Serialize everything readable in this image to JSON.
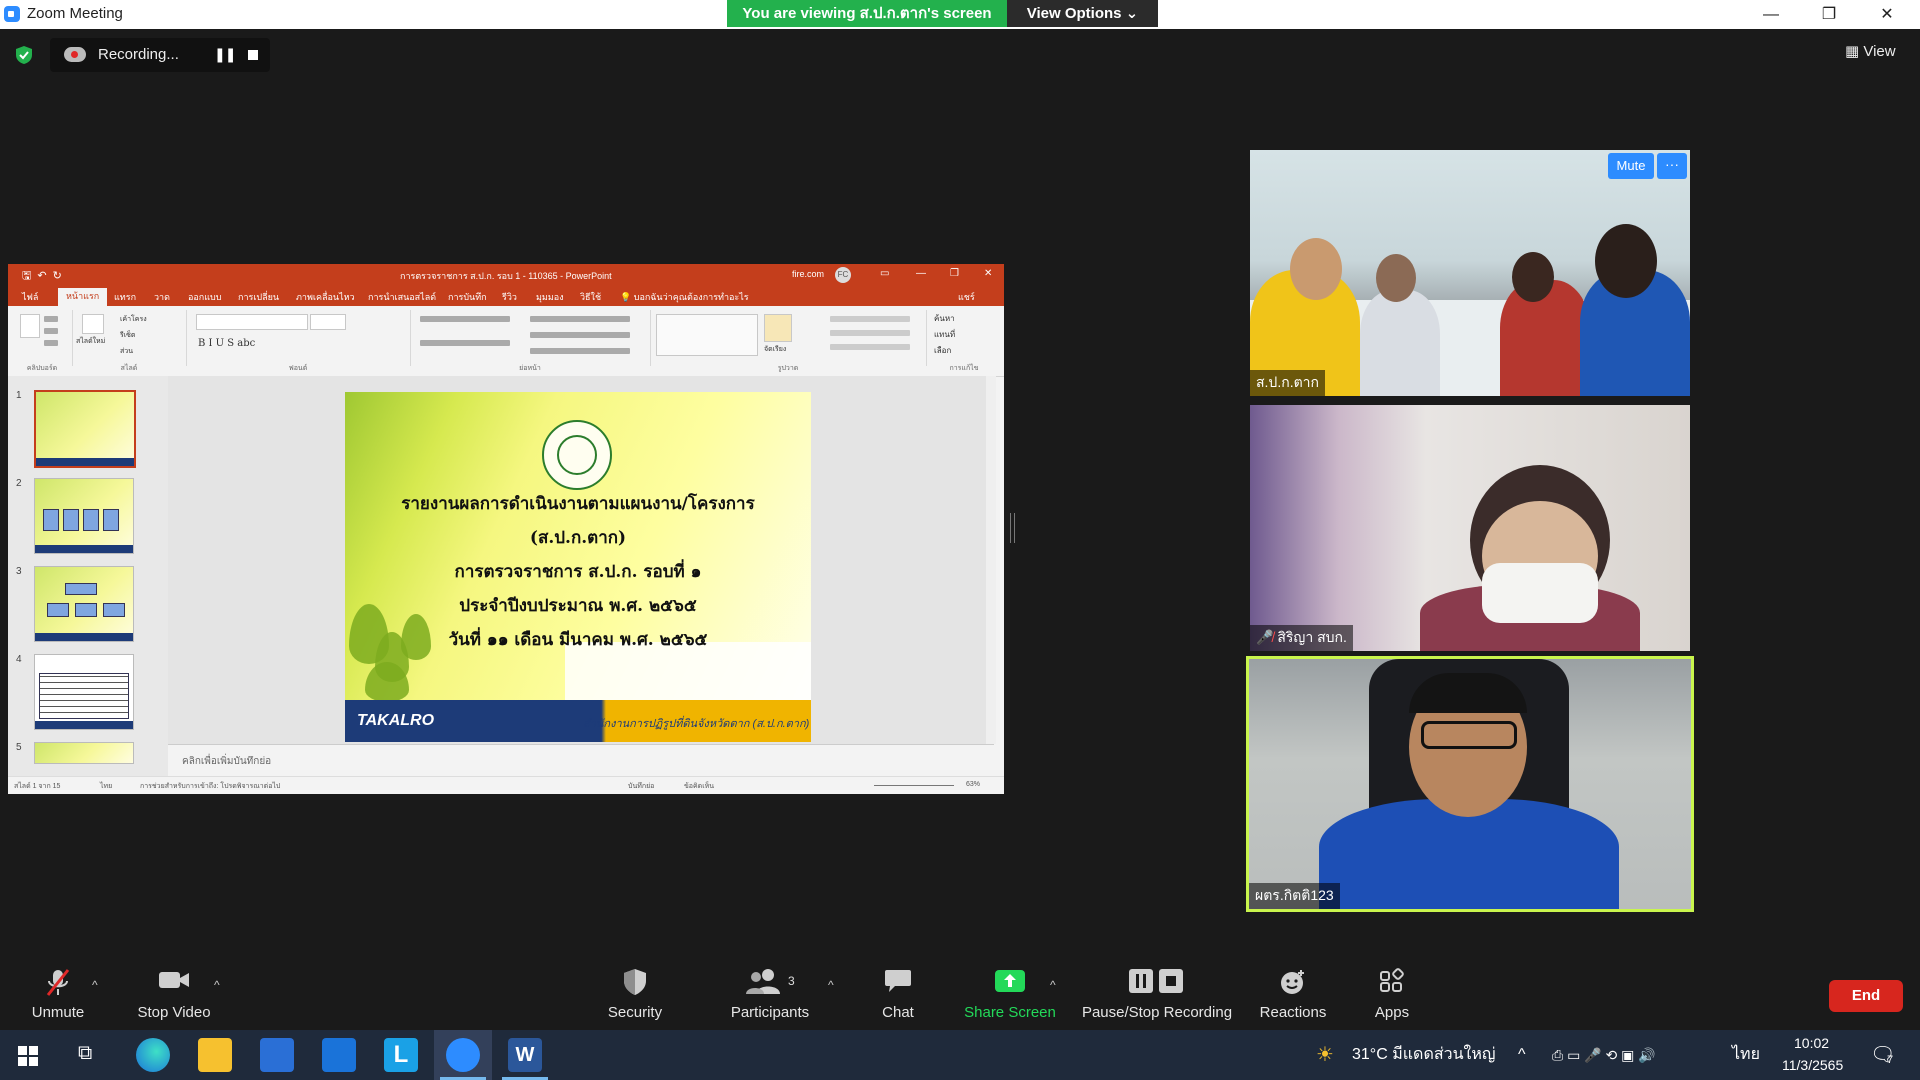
{
  "window": {
    "title": "Zoom Meeting",
    "viewing_banner": "You are viewing ส.ป.ก.ตาก's screen",
    "view_options": "View Options",
    "minimize": "—",
    "restore": "❐",
    "close": "✕"
  },
  "recording": {
    "label": "Recording...",
    "pause_glyph": "❚❚"
  },
  "view_button": "View",
  "shared_screen": {
    "doc_title": "การตรวจราชการ ส.ป.ก. รอบ 1 - 110365 - PowerPoint",
    "account": "fire.com",
    "avatar": "FC",
    "share": "แชร์",
    "tabs": [
      "ไฟล์",
      "หน้าแรก",
      "แทรก",
      "วาด",
      "ออกแบบ",
      "การเปลี่ยน",
      "ภาพเคลื่อนไหว",
      "การนำเสนอสไลด์",
      "การบันทึก",
      "รีวิว",
      "มุมมอง",
      "วิธีใช้",
      "บอกฉันว่าคุณต้องการทำอะไร"
    ],
    "ribbon_groups": [
      "คลิปบอร์ด",
      "สไลด์",
      "ฟอนต์",
      "ย่อหน้า",
      "รูปวาด",
      "การแก้ไข"
    ],
    "ribbon_items": {
      "find": "ค้นหา",
      "replace": "แทนที่",
      "select": "เลือก",
      "layout": "เค้าโครง",
      "reset": "รีเซ็ต",
      "section": "ส่วน",
      "new_slide": "สไลด์ใหม่",
      "arrange": "จัดเรียง"
    },
    "slide_numbers": [
      "1",
      "2",
      "3",
      "4",
      "5"
    ],
    "notes_placeholder": "คลิกเพื่อเพิ่มบันทึกย่อ",
    "status_left": "สไลด์ 1 จาก 15",
    "status_lang": "ไทย",
    "status_access": "การช่วยสำหรับการเข้าถึง: โปรดพิจารณาต่อไป",
    "status_notes": "บันทึกย่อ",
    "status_comments": "ข้อคิดเห็น",
    "zoom": "63%",
    "slide": {
      "line1": "รายงานผลการดำเนินงานตามแผนงาน/โครงการ",
      "line2": "(ส.ป.ก.ตาก)",
      "line3": "การตรวจราชการ ส.ป.ก. รอบที่ ๑",
      "line4": "ประจำปีงบประมาณ พ.ศ. ๒๕๖๕",
      "line5": "วันที่ ๑๑   เดือน มีนาคม  พ.ศ. ๒๕๖๕",
      "brand": "TAKALRO",
      "org": "สำนักงานการปฏิรูปที่ดินจังหวัดตาก (ส.ป.ก.ตาก)"
    }
  },
  "participants": [
    {
      "name": "ส.ป.ก.ตาก",
      "muted": false
    },
    {
      "name": "สิริญา สบก.",
      "muted": true
    },
    {
      "name": "ผตร.กิตติ123",
      "muted": false,
      "active_speaker": true
    }
  ],
  "tile_controls": {
    "mute": "Mute",
    "more": "···"
  },
  "toolbar": {
    "unmute": "Unmute",
    "stop_video": "Stop Video",
    "security": "Security",
    "participants": "Participants",
    "participants_count": "3",
    "chat": "Chat",
    "share_screen": "Share Screen",
    "pause_stop_recording": "Pause/Stop Recording",
    "reactions": "Reactions",
    "apps": "Apps",
    "end": "End",
    "caret": "^"
  },
  "taskbar": {
    "weather": "31°C  มีแดดส่วนใหญ่",
    "language": "ไทย",
    "time": "10:02",
    "date": "11/3/2565",
    "notifications": "7"
  },
  "colors": {
    "zoom_blue": "#2d8cff",
    "viewing_green": "#23b14d",
    "share_green": "#23d959",
    "end_red": "#d7261e",
    "ppt_red": "#c43e1c",
    "active_speaker": "#c9f54d"
  }
}
